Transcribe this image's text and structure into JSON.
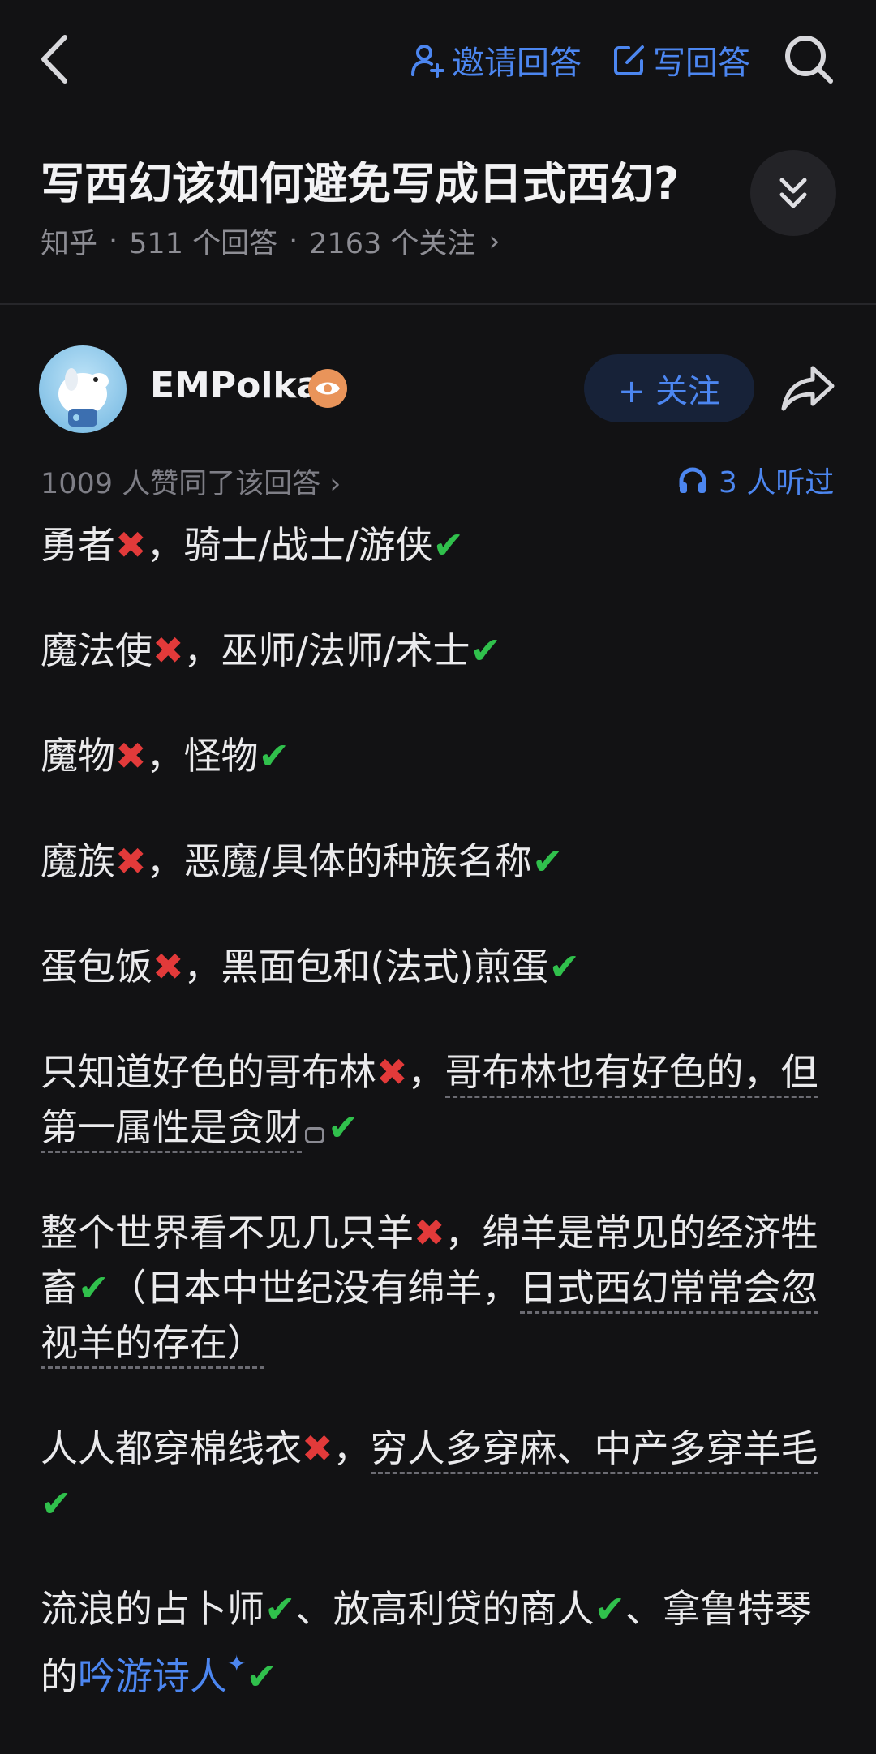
{
  "topbar": {
    "invite_label": "邀请回答",
    "write_label": "写回答"
  },
  "question": {
    "title": "写西幻该如何避免写成日式西幻?",
    "source": "知乎",
    "answers": "511 个回答",
    "followers": "2163 个关注",
    "meta_chevron": "›"
  },
  "answer": {
    "author": "EMPolka",
    "follow_label": "+ 关注",
    "votes": "1009 人赞同了该回答 ›",
    "listened": "3 人听过",
    "paragraphs": {
      "p1": {
        "a": "勇者",
        "b": "，骑士/战士/游侠"
      },
      "p2": {
        "a": "魔法使",
        "b": "，巫师/法师/术士"
      },
      "p3": {
        "a": "魔物",
        "b": "，怪物"
      },
      "p4": {
        "a": "魔族",
        "b": "，恶魔/具体的种族名称"
      },
      "p5": {
        "a": "蛋包饭",
        "b": "，黑面包和(法式)煎蛋"
      },
      "p6": {
        "a": "只知道好色的哥布林",
        "b1": "，",
        "b2": "哥布林也有好色的，但第一属性是贪财"
      },
      "p7": {
        "a": "整个世界看不见几只羊",
        "b1": "，",
        "b2": "绵羊是常见的经济牲畜",
        "c1": "（日本中世纪没有绵羊，",
        "c2": "日式西幻常常会忽视羊的存在）"
      },
      "p8": {
        "a": "人人都穿棉线衣",
        "b1": "，",
        "b2": "穷人多穿麻、中产多穿羊毛"
      },
      "p9": {
        "a": "流浪的占卜师",
        "b": "、放高利贷的商人",
        "c": "、拿鲁特琴的",
        "link": "吟游诗人"
      }
    }
  },
  "marks": {
    "ok": "✔",
    "no": "✖"
  },
  "colors": {
    "accent": "#4c86f0",
    "ok": "#30c04c",
    "no": "#e23a3a",
    "background": "#121214"
  }
}
